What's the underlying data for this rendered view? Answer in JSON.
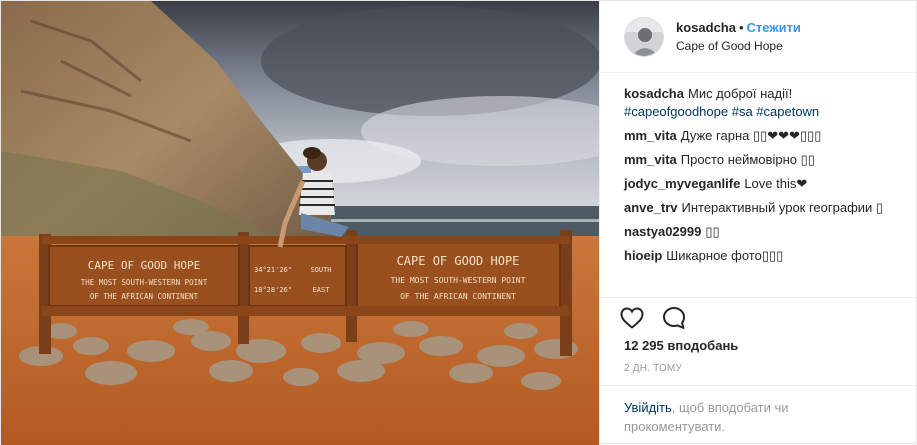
{
  "header": {
    "username": "kosadcha",
    "separator": "•",
    "follow_label": "Стежити",
    "location": "Cape of Good Hope"
  },
  "caption": {
    "username": "kosadcha",
    "text": "Мис доброї надії!",
    "hashtags": "#capeofgoodhope #sa #capetown"
  },
  "comments": [
    {
      "user": "mm_vita",
      "text": "Дуже гарна ▯▯❤❤❤▯▯▯"
    },
    {
      "user": "mm_vita",
      "text": "Просто неймовірно ▯▯"
    },
    {
      "user": "jodyc_myveganlife",
      "text": "Love this❤"
    },
    {
      "user": "anve_trv",
      "text": "Интерактивный урок географии ▯"
    },
    {
      "user": "nastya02999",
      "text": "▯▯"
    },
    {
      "user": "hioeip",
      "text": "Шикарное фото▯▯▯"
    }
  ],
  "actions": {
    "like_icon": "heart-icon",
    "comment_icon": "comment-icon",
    "likes_text": "12 295 вподобань",
    "time_text": "2 дн. тому"
  },
  "login_prompt": {
    "link": "Увійдіть",
    "rest": ", щоб вподобати чи прокоментувати."
  },
  "photo": {
    "sign_left_title": "CAPE OF GOOD HOPE",
    "sign_left_line1": "THE MOST SOUTH-WESTERN POINT",
    "sign_left_line2": "OF THE AFRICAN CONTINENT",
    "sign_mid_line1": "34°21'26\"",
    "sign_mid_line1b": "SOUTH",
    "sign_mid_line2": "18°28'26\"",
    "sign_mid_line2b": "EAST",
    "sign_right_title": "CAPE OF GOOD HOPE",
    "sign_right_line1": "THE MOST SOUTH-WESTERN POINT",
    "sign_right_line2": "OF THE AFRICAN CONTINENT"
  },
  "colors": {
    "link_blue": "#3897f0",
    "hashtag_blue": "#003569",
    "sign_wood": "#9a4f1e",
    "sign_text": "#f2e3c9"
  }
}
